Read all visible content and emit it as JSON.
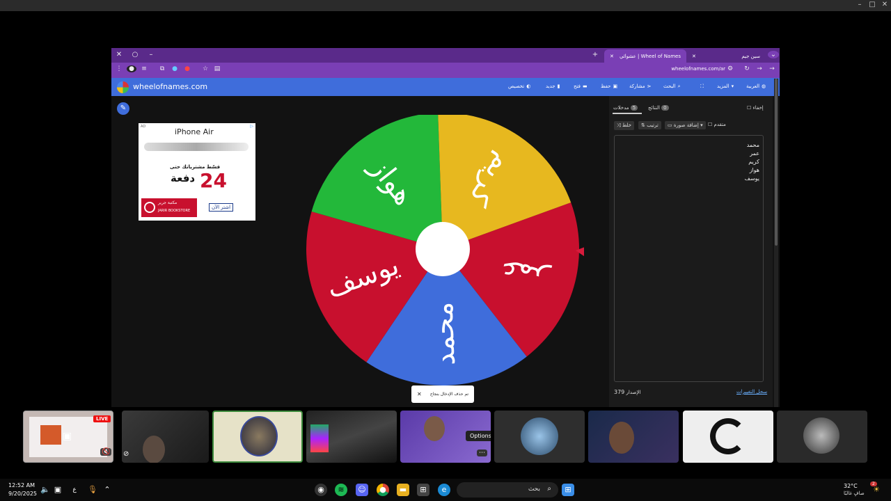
{
  "window_controls": {
    "minimize": "–",
    "maximize": "□",
    "close": "✕"
  },
  "browser": {
    "tabs": [
      {
        "label": "Wheel of Names | عشوائي",
        "active": true
      },
      {
        "label": "سين جيم",
        "active": false
      }
    ],
    "new_tab": "+",
    "url": "wheelofnames.com/ar"
  },
  "app": {
    "site_name": "wheelofnames.com",
    "menu": {
      "customize": "تخصيص",
      "new": "جديد",
      "open": "فتح",
      "save": "حفظ",
      "share": "مشاركة",
      "search": "البحث",
      "more": "المزيد",
      "language": "العربية"
    }
  },
  "ad": {
    "label": "AD",
    "product": "iPhone Air",
    "line1": "قسّط مشترياتك حتى",
    "number": "24",
    "line2": "دفعة",
    "brand_ar": "مكتبة جرير",
    "brand_en": "JARIR BOOKSTORE",
    "cta": "اشتر الآن"
  },
  "wheel": {
    "colors": [
      "#3f6ddb",
      "#c8102e",
      "#e7b81f",
      "#23b83a"
    ],
    "segments": [
      {
        "label": "عمر",
        "color": "#c8102e"
      },
      {
        "label": "محمد",
        "color": "#3f6ddb"
      },
      {
        "label": "يوسف",
        "color": "#c8102e"
      },
      {
        "label": "هواز",
        "color": "#23b83a"
      },
      {
        "label": "كريم",
        "color": "#e7b81f"
      }
    ]
  },
  "panel": {
    "hide_label": "إخفاء",
    "tab_entries": "مدخلات",
    "entries_count": "5",
    "tab_results": "النتائج",
    "results_count": "0",
    "shuffle": "خلط",
    "sort": "ترتيب",
    "add_image": "إضافة صورة",
    "advanced": "متقدم",
    "entries": [
      "محمد",
      "عمر",
      "كريم",
      "هواز",
      "يوسف"
    ],
    "version_label": "الإصدار",
    "version": "379",
    "changelog": "سجل التغييرات"
  },
  "toast": {
    "message": "تم حذف الإدخال بنجاح",
    "close": "✕"
  },
  "call": {
    "live_badge": "LIVE",
    "tooltip": "Options"
  },
  "taskbar": {
    "time": "12:52 AM",
    "date": "9/20/2025",
    "search_placeholder": "بحث",
    "weather_temp": "32°C",
    "weather_desc": "صافٍ غالبًا",
    "lang": "ع",
    "notif_count": "2"
  }
}
